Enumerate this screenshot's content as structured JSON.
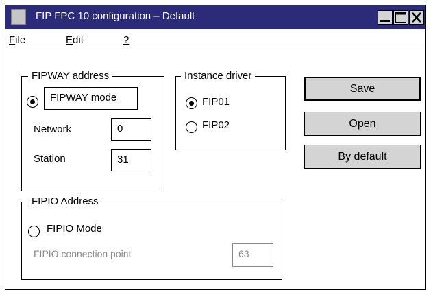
{
  "window": {
    "title": "FIP FPC 10 configuration – Default",
    "title_bar_color": "#2b2b7a"
  },
  "menu": {
    "items": [
      {
        "mnemonic": "F",
        "rest": "ile"
      },
      {
        "mnemonic": "E",
        "rest": "dit"
      },
      {
        "mnemonic": "?",
        "rest": ""
      }
    ]
  },
  "fipway": {
    "group_label": "FIPWAY address",
    "mode_label": "FIPWAY mode",
    "mode_selected": true,
    "network_label": "Network",
    "network_value": "0",
    "station_label": "Station",
    "station_value": "31"
  },
  "driver": {
    "group_label": "Instance driver",
    "options": [
      "FIP01",
      "FIP02"
    ],
    "selected": "FIP01"
  },
  "fipio": {
    "group_label": "FIPIO Address",
    "mode_label": "FIPIO Mode",
    "mode_selected": false,
    "connection_label": "FIPIO connection point",
    "connection_value": "63"
  },
  "buttons": {
    "save": "Save",
    "open": "Open",
    "by_default": "By default"
  }
}
